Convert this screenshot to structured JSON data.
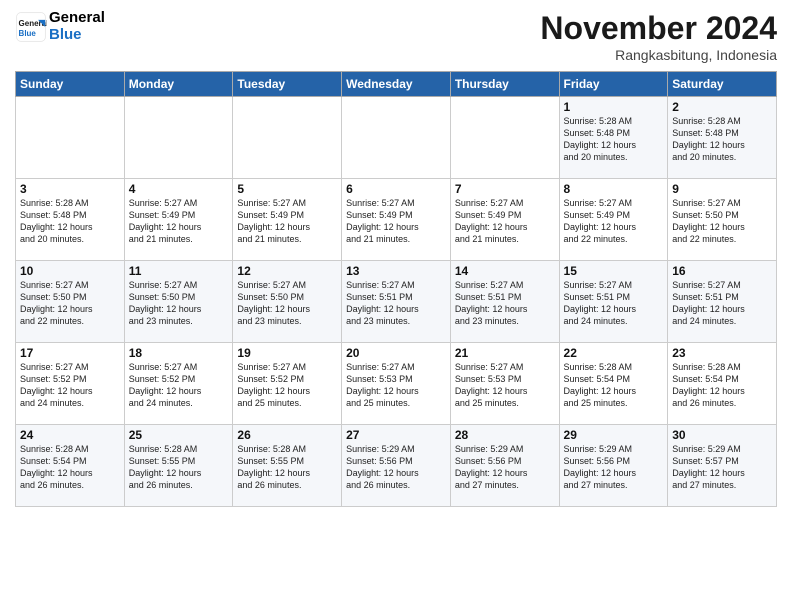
{
  "header": {
    "logo_line1": "General",
    "logo_line2": "Blue",
    "month_title": "November 2024",
    "subtitle": "Rangkasbitung, Indonesia"
  },
  "weekdays": [
    "Sunday",
    "Monday",
    "Tuesday",
    "Wednesday",
    "Thursday",
    "Friday",
    "Saturday"
  ],
  "weeks": [
    [
      {
        "day": "",
        "info": ""
      },
      {
        "day": "",
        "info": ""
      },
      {
        "day": "",
        "info": ""
      },
      {
        "day": "",
        "info": ""
      },
      {
        "day": "",
        "info": ""
      },
      {
        "day": "1",
        "info": "Sunrise: 5:28 AM\nSunset: 5:48 PM\nDaylight: 12 hours\nand 20 minutes."
      },
      {
        "day": "2",
        "info": "Sunrise: 5:28 AM\nSunset: 5:48 PM\nDaylight: 12 hours\nand 20 minutes."
      }
    ],
    [
      {
        "day": "3",
        "info": "Sunrise: 5:28 AM\nSunset: 5:48 PM\nDaylight: 12 hours\nand 20 minutes."
      },
      {
        "day": "4",
        "info": "Sunrise: 5:27 AM\nSunset: 5:49 PM\nDaylight: 12 hours\nand 21 minutes."
      },
      {
        "day": "5",
        "info": "Sunrise: 5:27 AM\nSunset: 5:49 PM\nDaylight: 12 hours\nand 21 minutes."
      },
      {
        "day": "6",
        "info": "Sunrise: 5:27 AM\nSunset: 5:49 PM\nDaylight: 12 hours\nand 21 minutes."
      },
      {
        "day": "7",
        "info": "Sunrise: 5:27 AM\nSunset: 5:49 PM\nDaylight: 12 hours\nand 21 minutes."
      },
      {
        "day": "8",
        "info": "Sunrise: 5:27 AM\nSunset: 5:49 PM\nDaylight: 12 hours\nand 22 minutes."
      },
      {
        "day": "9",
        "info": "Sunrise: 5:27 AM\nSunset: 5:50 PM\nDaylight: 12 hours\nand 22 minutes."
      }
    ],
    [
      {
        "day": "10",
        "info": "Sunrise: 5:27 AM\nSunset: 5:50 PM\nDaylight: 12 hours\nand 22 minutes."
      },
      {
        "day": "11",
        "info": "Sunrise: 5:27 AM\nSunset: 5:50 PM\nDaylight: 12 hours\nand 23 minutes."
      },
      {
        "day": "12",
        "info": "Sunrise: 5:27 AM\nSunset: 5:50 PM\nDaylight: 12 hours\nand 23 minutes."
      },
      {
        "day": "13",
        "info": "Sunrise: 5:27 AM\nSunset: 5:51 PM\nDaylight: 12 hours\nand 23 minutes."
      },
      {
        "day": "14",
        "info": "Sunrise: 5:27 AM\nSunset: 5:51 PM\nDaylight: 12 hours\nand 23 minutes."
      },
      {
        "day": "15",
        "info": "Sunrise: 5:27 AM\nSunset: 5:51 PM\nDaylight: 12 hours\nand 24 minutes."
      },
      {
        "day": "16",
        "info": "Sunrise: 5:27 AM\nSunset: 5:51 PM\nDaylight: 12 hours\nand 24 minutes."
      }
    ],
    [
      {
        "day": "17",
        "info": "Sunrise: 5:27 AM\nSunset: 5:52 PM\nDaylight: 12 hours\nand 24 minutes."
      },
      {
        "day": "18",
        "info": "Sunrise: 5:27 AM\nSunset: 5:52 PM\nDaylight: 12 hours\nand 24 minutes."
      },
      {
        "day": "19",
        "info": "Sunrise: 5:27 AM\nSunset: 5:52 PM\nDaylight: 12 hours\nand 25 minutes."
      },
      {
        "day": "20",
        "info": "Sunrise: 5:27 AM\nSunset: 5:53 PM\nDaylight: 12 hours\nand 25 minutes."
      },
      {
        "day": "21",
        "info": "Sunrise: 5:27 AM\nSunset: 5:53 PM\nDaylight: 12 hours\nand 25 minutes."
      },
      {
        "day": "22",
        "info": "Sunrise: 5:28 AM\nSunset: 5:54 PM\nDaylight: 12 hours\nand 25 minutes."
      },
      {
        "day": "23",
        "info": "Sunrise: 5:28 AM\nSunset: 5:54 PM\nDaylight: 12 hours\nand 26 minutes."
      }
    ],
    [
      {
        "day": "24",
        "info": "Sunrise: 5:28 AM\nSunset: 5:54 PM\nDaylight: 12 hours\nand 26 minutes."
      },
      {
        "day": "25",
        "info": "Sunrise: 5:28 AM\nSunset: 5:55 PM\nDaylight: 12 hours\nand 26 minutes."
      },
      {
        "day": "26",
        "info": "Sunrise: 5:28 AM\nSunset: 5:55 PM\nDaylight: 12 hours\nand 26 minutes."
      },
      {
        "day": "27",
        "info": "Sunrise: 5:29 AM\nSunset: 5:56 PM\nDaylight: 12 hours\nand 26 minutes."
      },
      {
        "day": "28",
        "info": "Sunrise: 5:29 AM\nSunset: 5:56 PM\nDaylight: 12 hours\nand 27 minutes."
      },
      {
        "day": "29",
        "info": "Sunrise: 5:29 AM\nSunset: 5:56 PM\nDaylight: 12 hours\nand 27 minutes."
      },
      {
        "day": "30",
        "info": "Sunrise: 5:29 AM\nSunset: 5:57 PM\nDaylight: 12 hours\nand 27 minutes."
      }
    ]
  ]
}
